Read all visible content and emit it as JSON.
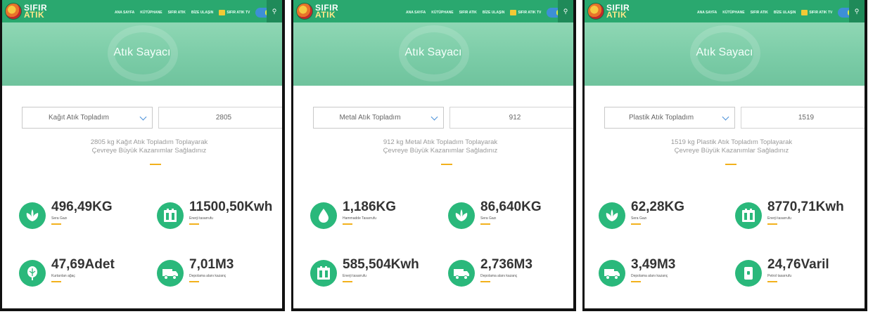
{
  "brand": {
    "line1": "SIFIR",
    "line2": "ATIK"
  },
  "nav": {
    "items": [
      "ANA SAYFA",
      "KÜTÜPHANE",
      "SIFIR ATIK",
      "BİZE ULAŞIN"
    ],
    "tv": "SIFIR ATIK TV"
  },
  "colors": {
    "accent": "#2aa86f",
    "icon_bg": "#2ab87b",
    "underline": "#f2b11c"
  },
  "panels": [
    {
      "hero_title": "Atık Sayacı",
      "select_value": "Kağıt Atık Topladım",
      "quantity": "2805",
      "summary_line1": "2805 kg Kağıt Atık Topladım Toplayarak",
      "summary_line2": "Çevreye Büyük Kazanımlar Sağladınız",
      "stats": [
        {
          "icon": "leaf-icon",
          "value": "496,49KG",
          "label": "Sera Gazı"
        },
        {
          "icon": "battery-icon",
          "value": "11500,50Kwh",
          "label": "Enerji tasarrufu"
        },
        {
          "icon": "tree-icon",
          "value": "47,69Adet",
          "label": "Kurtarılan ağaç"
        },
        {
          "icon": "truck-icon",
          "value": "7,01M3",
          "label": "Depolama alanı kazanç"
        }
      ]
    },
    {
      "hero_title": "Atık Sayacı",
      "select_value": "Metal Atık Topladım",
      "quantity": "912",
      "summary_line1": "912 kg Metal Atık Topladım Toplayarak",
      "summary_line2": "Çevreye Büyük Kazanımlar Sağladınız",
      "stats": [
        {
          "icon": "drop-icon",
          "value": "1,186KG",
          "label": "Hammadde Tasarrufu"
        },
        {
          "icon": "leaf-icon",
          "value": "86,640KG",
          "label": "Sera Gazı"
        },
        {
          "icon": "battery-icon",
          "value": "585,504Kwh",
          "label": "Enerji tasarrufu"
        },
        {
          "icon": "truck-icon",
          "value": "2,736M3",
          "label": "Depolama alanı kazanç"
        }
      ]
    },
    {
      "hero_title": "Atık Sayacı",
      "select_value": "Plastik Atık Topladım",
      "quantity": "1519",
      "summary_line1": "1519 kg Plastik Atık Topladım Toplayarak",
      "summary_line2": "Çevreye Büyük Kazanımlar Sağladınız",
      "stats": [
        {
          "icon": "leaf-icon",
          "value": "62,28KG",
          "label": "Sera Gazı"
        },
        {
          "icon": "battery-icon",
          "value": "8770,71Kwh",
          "label": "Enerji tasarrufu"
        },
        {
          "icon": "truck-icon",
          "value": "3,49M3",
          "label": "Depolama alanı kazanç"
        },
        {
          "icon": "barrel-icon",
          "value": "24,76Varil",
          "label": "Petrol tasarrufu"
        }
      ]
    }
  ]
}
